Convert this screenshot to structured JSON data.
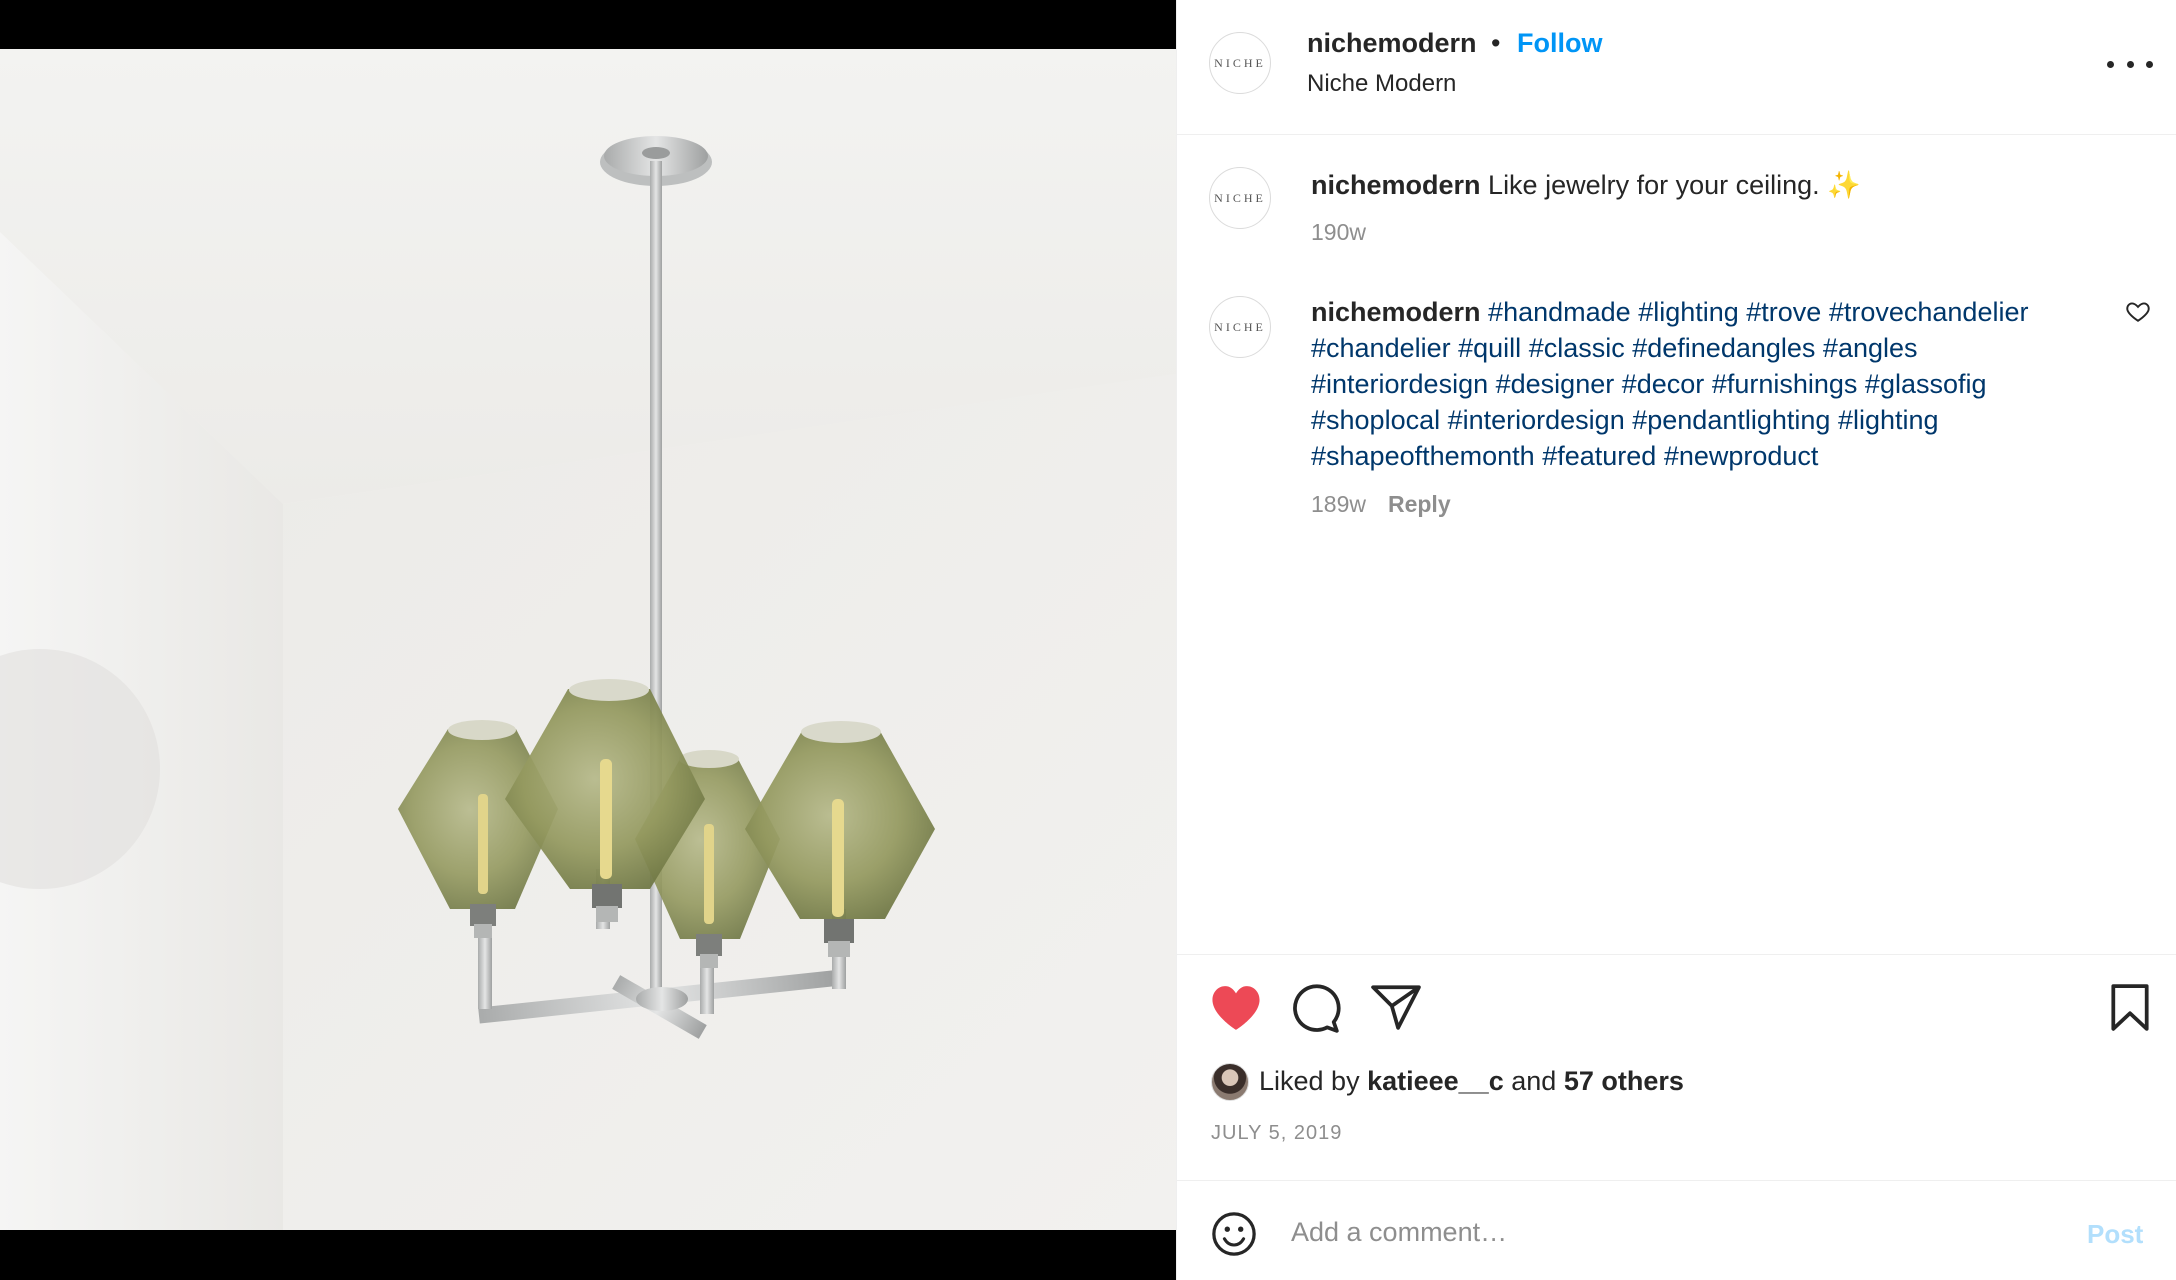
{
  "post": {
    "author": {
      "username": "nichemodern",
      "display_name": "Niche Modern",
      "avatar_text": "NICHE",
      "follow_label": "Follow",
      "separator": "•"
    },
    "comments": [
      {
        "username": "nichemodern",
        "text": "Like jewelry for your ceiling. ✨",
        "age": "190w"
      },
      {
        "username": "nichemodern",
        "hashtags": [
          "#handmade",
          "#lighting",
          "#trove",
          "#trovechandelier",
          "#chandelier",
          "#quill",
          "#classic",
          "#definedangles",
          "#angles",
          "#interiordesign",
          "#designer",
          "#decor",
          "#furnishings",
          "#glassofig",
          "#shoplocal",
          "#interiordesign",
          "#pendantlighting",
          "#lighting",
          "#shapeofthemonth",
          "#featured",
          "#newproduct"
        ],
        "age": "189w",
        "reply_label": "Reply"
      }
    ],
    "likes": {
      "prefix": "Liked by",
      "user": "katieee__c",
      "joiner": "and",
      "others": "57 others"
    },
    "date": "JULY 5, 2019",
    "add_comment": {
      "placeholder": "Add a comment…",
      "post_label": "Post"
    },
    "icons": {
      "like": "heart-filled-icon",
      "comment": "speech-bubble-icon",
      "share": "paper-plane-icon",
      "save": "bookmark-icon",
      "more": "more-options-icon",
      "emoji": "emoji-icon"
    },
    "colors": {
      "like_red": "#ed4956",
      "follow_blue": "#0095f6",
      "hashtag_blue": "#00376b",
      "post_disabled": "#b2dffc",
      "glass_green": "#8f9a5c"
    }
  }
}
